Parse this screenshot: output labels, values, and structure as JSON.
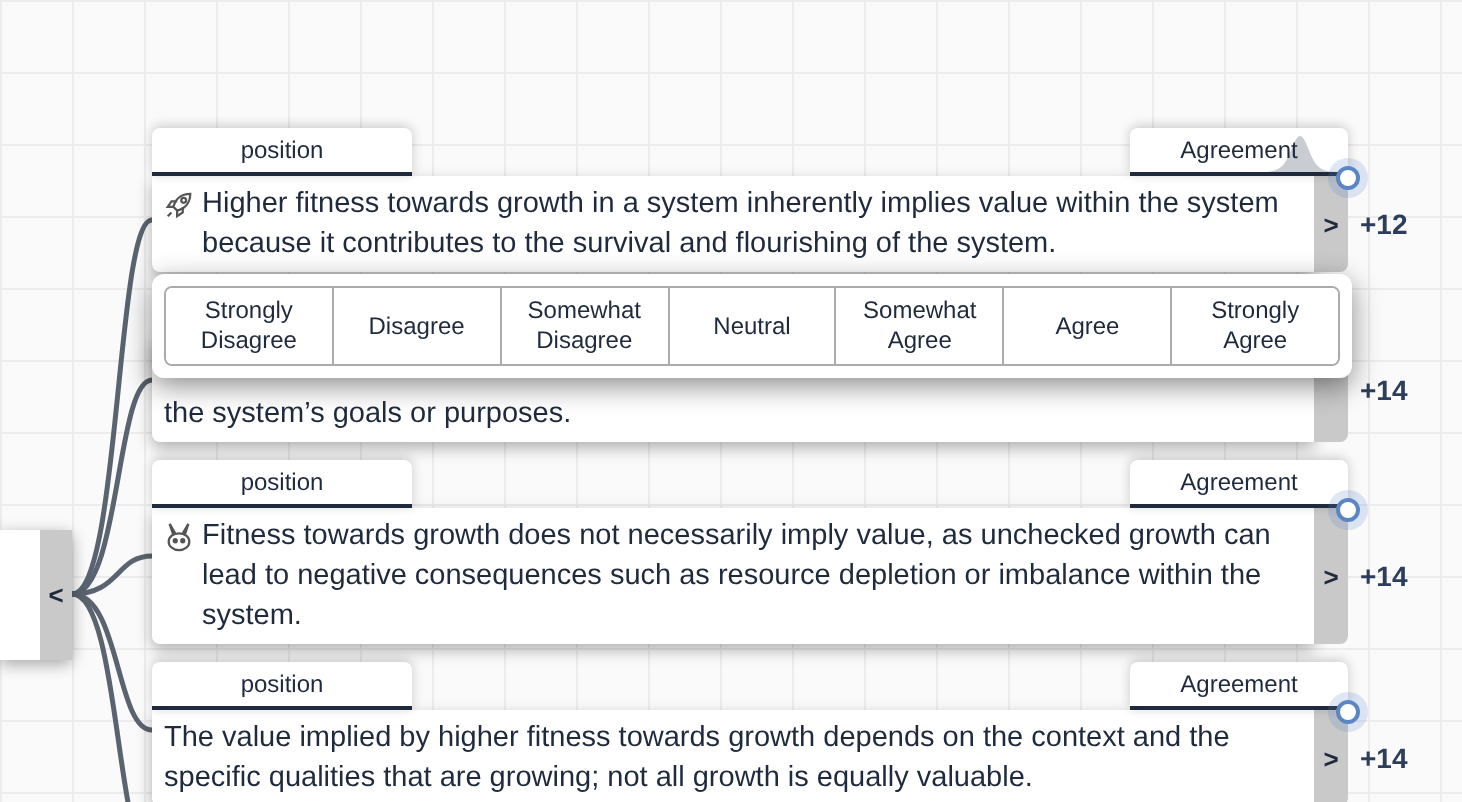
{
  "collapse_toggle": "<",
  "cards": [
    {
      "kind": "rocket",
      "position_tab": "position",
      "agreement_tab": "Agreement",
      "distribution_shown": true,
      "text": "Higher fitness towards growth in a system inherently implies value within the system because it contributes to the survival and flourishing of the system.",
      "expand": ">",
      "score": "+12"
    },
    {
      "kind": "covered",
      "text": "the system’s goals or purposes.",
      "score": "+14"
    },
    {
      "kind": "rabbit",
      "position_tab": "position",
      "agreement_tab": "Agreement",
      "distribution_shown": false,
      "text": "Fitness towards growth does not necessarily imply value, as unchecked growth can lead to negative consequences such as resource depletion or imbalance within the system.",
      "expand": ">",
      "score": "+14"
    },
    {
      "kind": "plain",
      "position_tab": "position",
      "agreement_tab": "Agreement",
      "distribution_shown": false,
      "text": "The value implied by higher fitness towards growth depends on the context and the specific qualities that are growing; not all growth is equally valuable.",
      "expand": ">",
      "score": "+14"
    }
  ],
  "rating_popup": {
    "options": [
      "Strongly Disagree",
      "Disagree",
      "Somewhat Disagree",
      "Neutral",
      "Somewhat Agree",
      "Agree",
      "Strongly Agree"
    ]
  }
}
